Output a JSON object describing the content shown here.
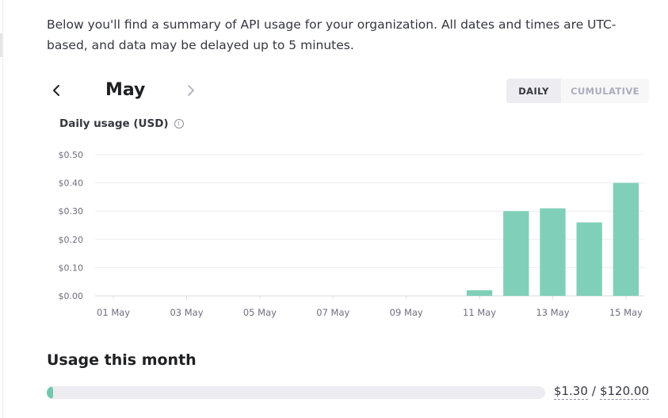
{
  "intro_text": "Below you'll find a summary of API usage for your organization. All dates and times are UTC-based, and data may be delayed up to 5 minutes.",
  "month_nav": {
    "month": "May",
    "prev_icon": "chevron-left-icon",
    "next_icon": "chevron-right-icon"
  },
  "view_toggle": {
    "daily_label": "DAILY",
    "cumulative_label": "CUMULATIVE",
    "selected": "DAILY"
  },
  "chart_title": "Daily usage (USD)",
  "chart_data": {
    "type": "bar",
    "title": "Daily usage (USD)",
    "xlabel": "",
    "ylabel": "",
    "categories": [
      "01 May",
      "02 May",
      "03 May",
      "04 May",
      "05 May",
      "06 May",
      "07 May",
      "08 May",
      "09 May",
      "10 May",
      "11 May",
      "12 May",
      "13 May",
      "14 May",
      "15 May"
    ],
    "x_tick_labels": [
      "01 May",
      "03 May",
      "05 May",
      "07 May",
      "09 May",
      "11 May",
      "13 May",
      "15 May"
    ],
    "values": [
      0,
      0,
      0,
      0,
      0,
      0,
      0,
      0,
      0,
      0,
      0.02,
      0.3,
      0.31,
      0.26,
      0.4
    ],
    "ylim": [
      0,
      0.5
    ],
    "y_ticks": [
      0.0,
      0.1,
      0.2,
      0.3,
      0.4,
      0.5
    ],
    "y_tick_labels": [
      "$0.00",
      "$0.10",
      "$0.20",
      "$0.30",
      "$0.40",
      "$0.50"
    ],
    "grid": true,
    "bar_color": "#80d0b9"
  },
  "usage_month": {
    "title": "Usage this month",
    "used": "$1.30",
    "separator": "/",
    "limit": "$120.00",
    "fraction": 0.0108,
    "fill_color": "#74c7ad"
  }
}
